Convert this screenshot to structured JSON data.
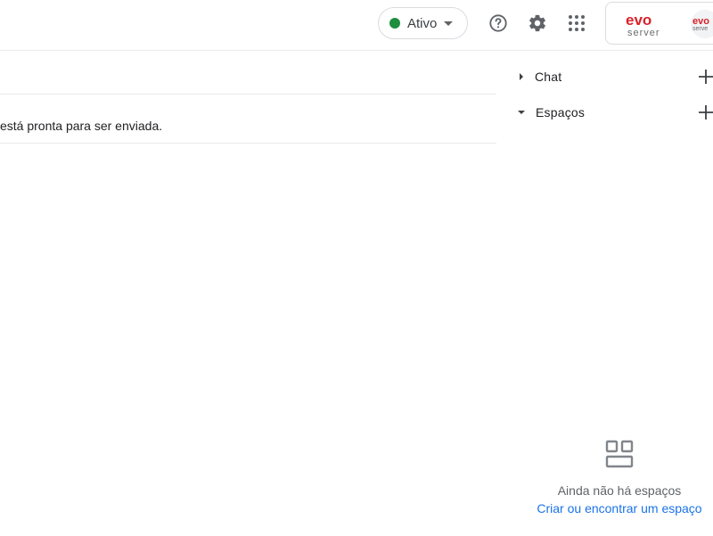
{
  "header": {
    "status": {
      "label": "Ativo",
      "dot_color": "#1e8e3e",
      "dropdown_icon": "caret-down-icon"
    },
    "icons": [
      "help-icon",
      "settings-gear-icon",
      "apps-grid-icon"
    ],
    "account": {
      "brand_logo_top": "evo",
      "brand_logo_bottom": "server",
      "brand_color": "#d9222a"
    }
  },
  "main": {
    "message_text": "está pronta para ser enviada."
  },
  "sidebar": {
    "sections": [
      {
        "label": "Chat",
        "expanded": false,
        "add_icon": "plus-icon"
      },
      {
        "label": "Espaços",
        "expanded": true,
        "add_icon": "plus-icon"
      }
    ],
    "empty_state": {
      "icon": "spaces-grid-icon",
      "message": "Ainda não há espaços",
      "link": "Criar ou encontrar um espaço"
    }
  }
}
